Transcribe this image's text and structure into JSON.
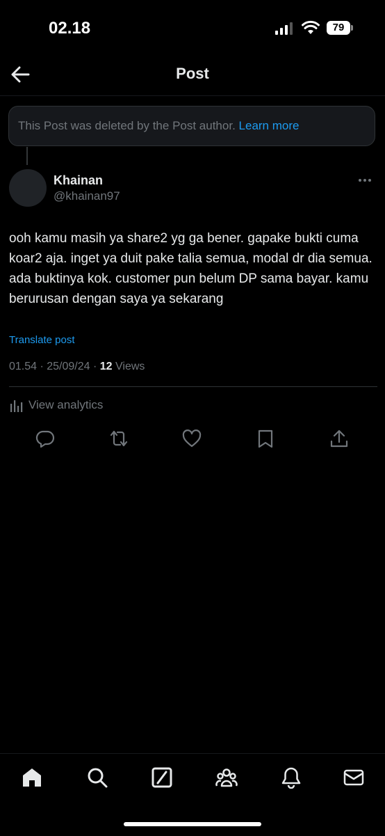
{
  "status": {
    "time": "02.18",
    "battery": "79"
  },
  "header": {
    "title": "Post"
  },
  "deleted_notice": {
    "text": "This Post was deleted by the Post author.",
    "link": "Learn more"
  },
  "post": {
    "author_name": "Khainan",
    "author_handle": "@khainan97",
    "text": "ooh kamu masih ya share2 yg ga bener. gapake bukti cuma koar2 aja. inget ya duit pake talia semua, modal dr dia semua. ada buktinya kok.  customer pun belum DP sama bayar. kamu berurusan dengan saya ya sekarang",
    "translate_label": "Translate post",
    "timestamp": "01.54 · 25/09/24 · ",
    "views_count": "12",
    "views_label": " Views",
    "analytics_label": "View analytics"
  },
  "icons": {
    "back": "back-arrow-icon",
    "more": "more-icon",
    "actions": [
      "reply-icon",
      "repost-icon",
      "like-icon",
      "bookmark-icon",
      "share-icon"
    ],
    "nav": [
      "home-icon",
      "search-icon",
      "grok-icon",
      "communities-icon",
      "notifications-icon",
      "messages-icon"
    ]
  },
  "colors": {
    "accent": "#1d9bf0",
    "background": "#000000",
    "secondary_text": "#71767b"
  }
}
